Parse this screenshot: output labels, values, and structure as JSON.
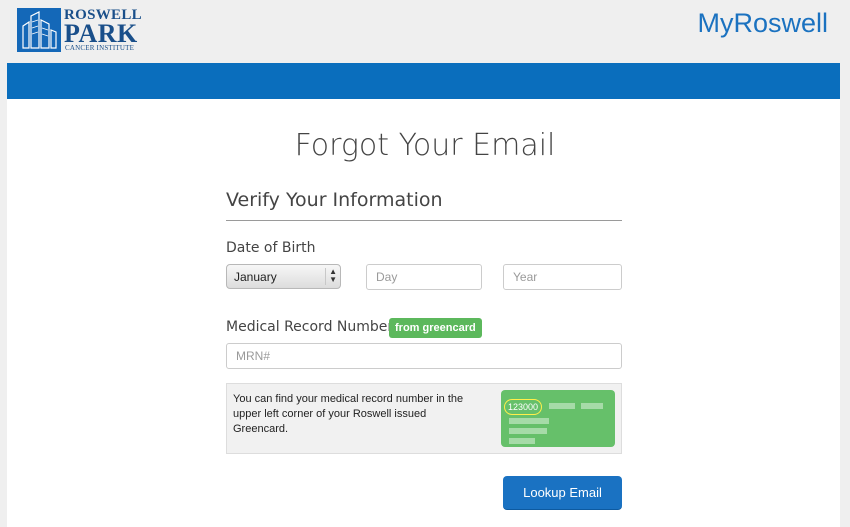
{
  "header": {
    "logo_line1": "ROSWELL",
    "logo_line2": "PARK",
    "logo_line3": "CANCER INSTITUTE",
    "brand_part1": "My",
    "brand_part2": "Roswell"
  },
  "page": {
    "title": "Forgot Your Email",
    "section_title": "Verify Your Information"
  },
  "dob": {
    "label": "Date of Birth",
    "month_value": "January",
    "day_placeholder": "Day",
    "year_placeholder": "Year"
  },
  "mrn": {
    "label": "Medical Record Number",
    "badge": "from greencard",
    "placeholder": "MRN#"
  },
  "info": {
    "text": "You can find your medical record number in the upper left corner of your Roswell issued Greencard.",
    "card_number": "123000"
  },
  "actions": {
    "lookup_label": "Lookup Email"
  },
  "colors": {
    "accent": "#0a6ebd",
    "button": "#1a72c2",
    "badge": "#5cb85c",
    "greencard": "#66c06a",
    "highlight": "#ffef4a"
  }
}
